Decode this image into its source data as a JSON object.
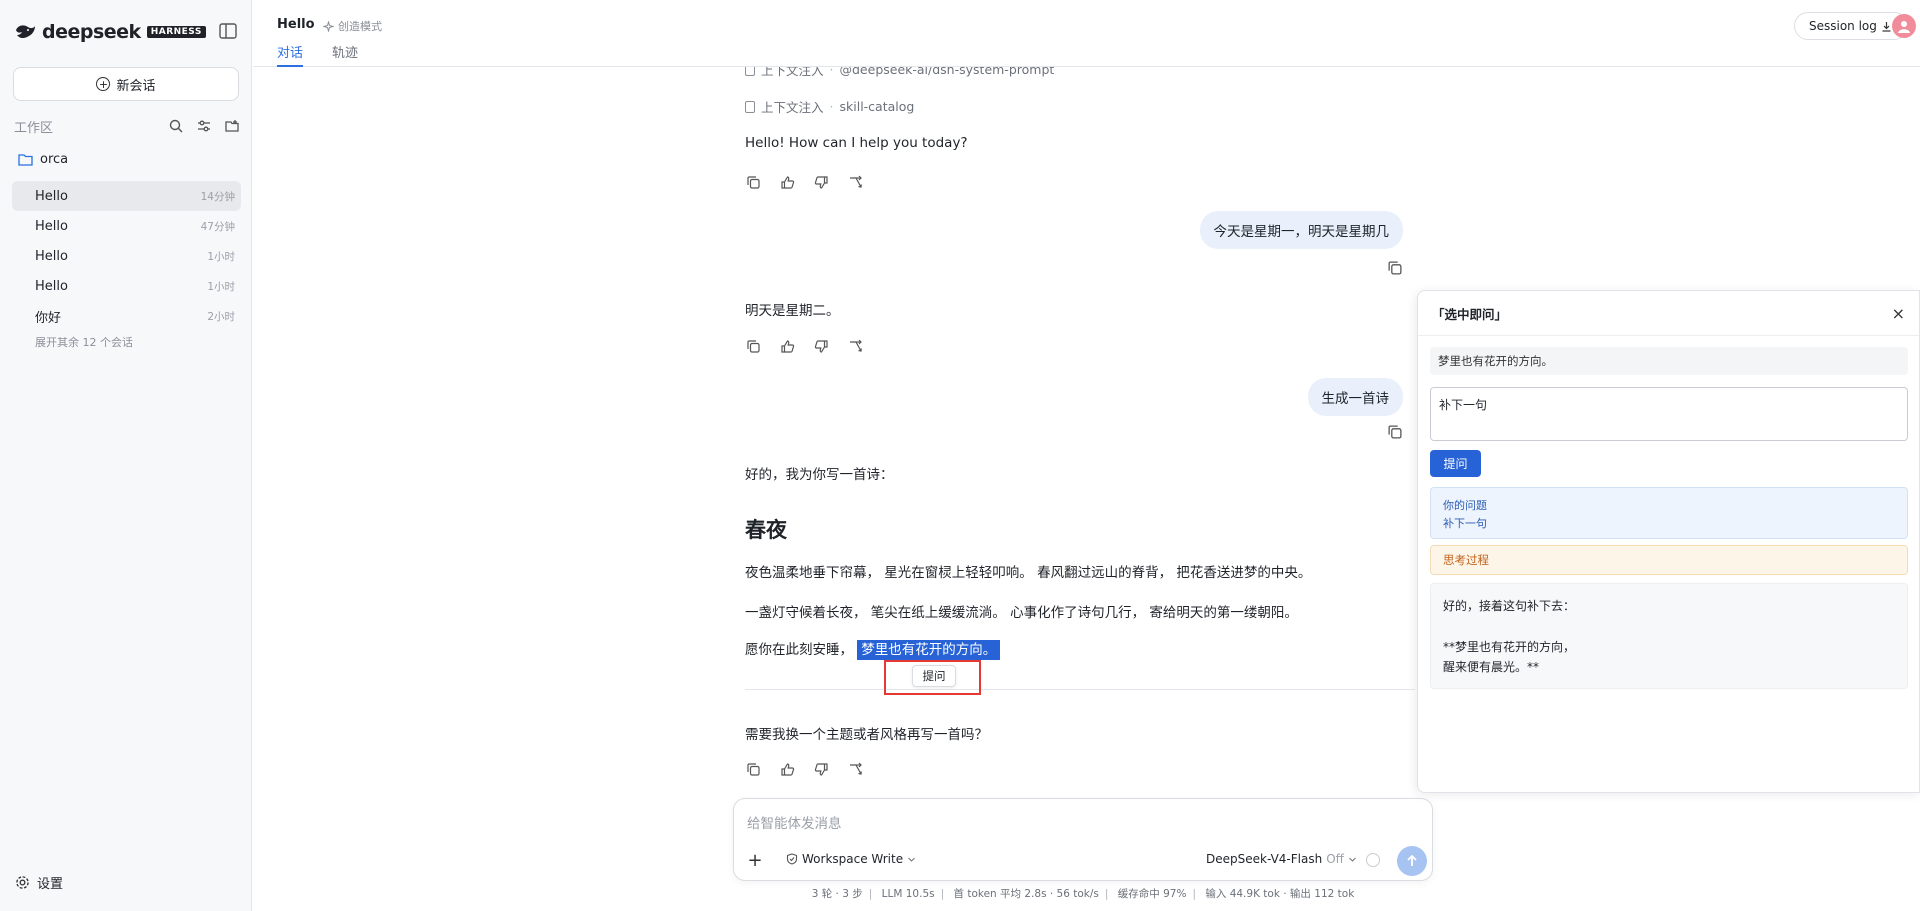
{
  "brand": {
    "name": "deepseek",
    "badge": "HARNESS"
  },
  "sidebar": {
    "new_chat": "新会话",
    "workspace_label": "工作区",
    "project": "orca",
    "sessions": [
      {
        "title": "Hello",
        "time": "14分钟"
      },
      {
        "title": "Hello",
        "time": "47分钟"
      },
      {
        "title": "Hello",
        "time": "1小时"
      },
      {
        "title": "Hello",
        "time": "1小时"
      },
      {
        "title": "你好",
        "time": "2小时"
      }
    ],
    "expand_more": "展开其余 12 个会话",
    "settings": "设置"
  },
  "topbar": {
    "title": "Hello",
    "mode": "创造模式",
    "tabs": [
      "对话",
      "轨迹"
    ],
    "session_log": "Session log"
  },
  "chat": {
    "inject_label": "上下文注入",
    "injects": [
      "@deepseek-ai/dsh-system-prompt",
      "skill-catalog"
    ],
    "msg1": "Hello! How can I help you today?",
    "user1": "今天是星期一，明天是星期几",
    "msg2": "明天是星期二。",
    "user2": "生成一首诗",
    "msg3_intro": "好的，我为你写一首诗：",
    "poem_title": "春夜",
    "poem_line1": "夜色温柔地垂下帘幕， 星光在窗棂上轻轻叩响。 春风翻过远山的脊背， 把花香送进梦的中央。",
    "poem_line2": "一盏灯守候着长夜， 笔尖在纸上缓缓流淌。 心事化作了诗句几行， 寄给明天的第一缕朝阳。",
    "poem_line3_prefix": "愿你在此刻安睡，",
    "poem_line3_selected": "梦里也有花开的方向。",
    "ask_popup": "提问",
    "msg3_outro": "需要我换一个主题或者风格再写一首吗？"
  },
  "composer": {
    "placeholder": "给智能体发消息",
    "permission": "Workspace Write",
    "model": "DeepSeek-V4-Flash",
    "model_state": "Off"
  },
  "status": {
    "turns": "3 轮 · 3 步",
    "llm": "LLM 10.5s",
    "first_token": "首 token 平均 2.8s · 56 tok/s",
    "cache": "缓存命中 97%",
    "io": "输入 44.9K tok · 输出 112 tok"
  },
  "panel": {
    "title": "「选中即问」",
    "quote": "梦里也有花开的方向。",
    "input_value": "补下一句",
    "submit": "提问",
    "your_q_label": "你的问题",
    "your_q_text": "补下一句",
    "thinking": "思考过程",
    "answer_l1": "好的，接着这句补下去：",
    "answer_l2": "**梦里也有花开的方向，",
    "answer_l3": "醒来便有晨光。**"
  },
  "colors": {
    "accent": "#2763d6",
    "highlight": "#2763d6",
    "annotation": "#e53935"
  }
}
